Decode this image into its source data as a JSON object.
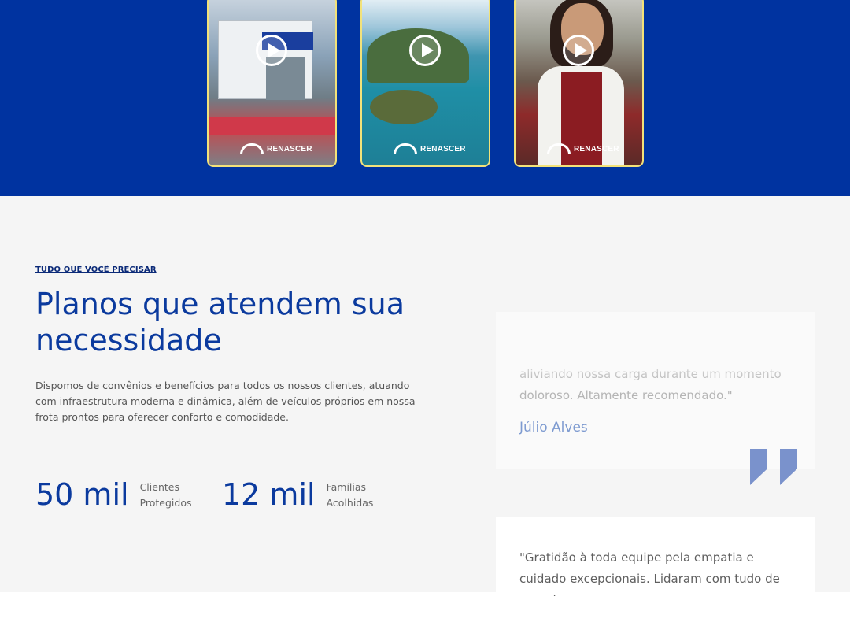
{
  "hero": {
    "cards": [
      {
        "brand": "RENASCER"
      },
      {
        "brand": "RENASCER"
      },
      {
        "brand": "RENASCER"
      }
    ]
  },
  "section": {
    "eyebrow": "TUDO QUE VOCÊ PRECISAR",
    "title": "Planos que atendem sua necessidade",
    "description": "Dispomos de convênios e benefícios para todos os nossos clientes, atuando com infraestrutura moderna e dinâmica, além de veículos próprios em nossa frota prontos para oferecer conforto e comodidade.",
    "stats": [
      {
        "number": "50 mil",
        "label_line1": "Clientes",
        "label_line2": "Protegidos"
      },
      {
        "number": "12 mil",
        "label_line1": "Famílias",
        "label_line2": "Acolhidas"
      }
    ]
  },
  "testimonials": [
    {
      "text": "aliviando nossa carga durante um momento doloroso. Altamente recomendado.\"",
      "author": "Júlio Alves"
    },
    {
      "text": "\"Gratidão à toda equipe pela empatia e cuidado excepcionais. Lidaram com tudo de maneira"
    }
  ],
  "colors": {
    "brand_blue": "#0033a0",
    "accent_yellow": "#f2e27a",
    "quote_blue": "#7a92cc"
  }
}
